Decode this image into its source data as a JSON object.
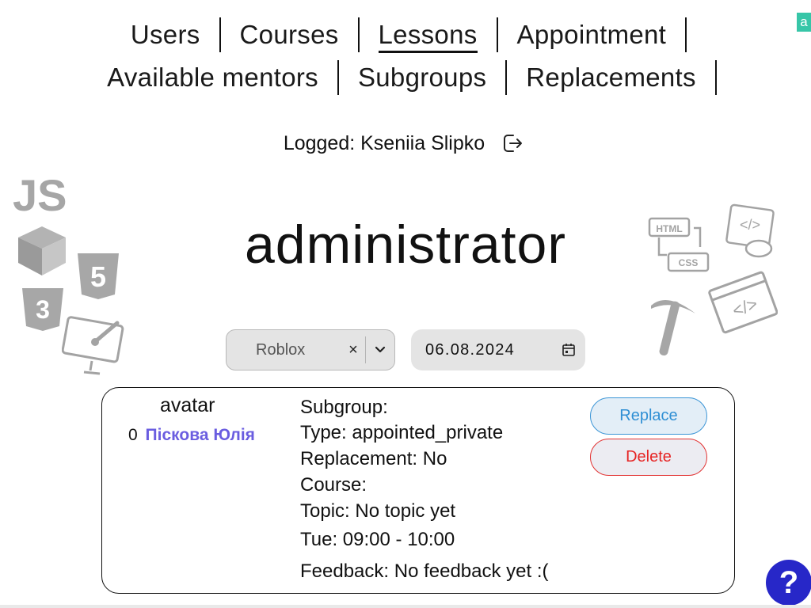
{
  "nav": {
    "row1": [
      "Users",
      "Courses",
      "Lessons",
      "Appointment"
    ],
    "row2": [
      "Available mentors",
      "Subgroups",
      "Replacements"
    ],
    "active": "Lessons"
  },
  "corner_badge": "a",
  "logged": {
    "text": "Logged: Kseniia Slipko",
    "icon": "logout-icon"
  },
  "role_title": "administrator",
  "filters": {
    "course_select": {
      "value": "Roblox",
      "clear": "×",
      "icon": "chevron-down-icon"
    },
    "date": {
      "value": "06.08.2024",
      "icon": "calendar-icon"
    }
  },
  "lesson": {
    "avatar_label": "avatar",
    "student_count": "0",
    "student_name": "Піскова Юлія",
    "subgroup": "Subgroup:",
    "type": "Type: appointed_private",
    "replacement": "Replacement: No",
    "course": "Course:",
    "topic": "Topic: No topic yet",
    "time": "Tue: 09:00 - 10:00",
    "feedback": "Feedback: No feedback yet :(",
    "replace_label": "Replace",
    "delete_label": "Delete"
  },
  "decorations": {
    "left": [
      "JS",
      "cube",
      "html5",
      "css3",
      "monitor-paint"
    ],
    "right": [
      "HTML",
      "CSS",
      "code-gamepad",
      "code-window",
      "pickaxe"
    ]
  },
  "help": {
    "label": "?"
  },
  "colors": {
    "link": "#6a5de0",
    "replace": "#2f8fd4",
    "delete": "#e62424",
    "help": "#2727c8",
    "badge": "#37c6a8"
  }
}
